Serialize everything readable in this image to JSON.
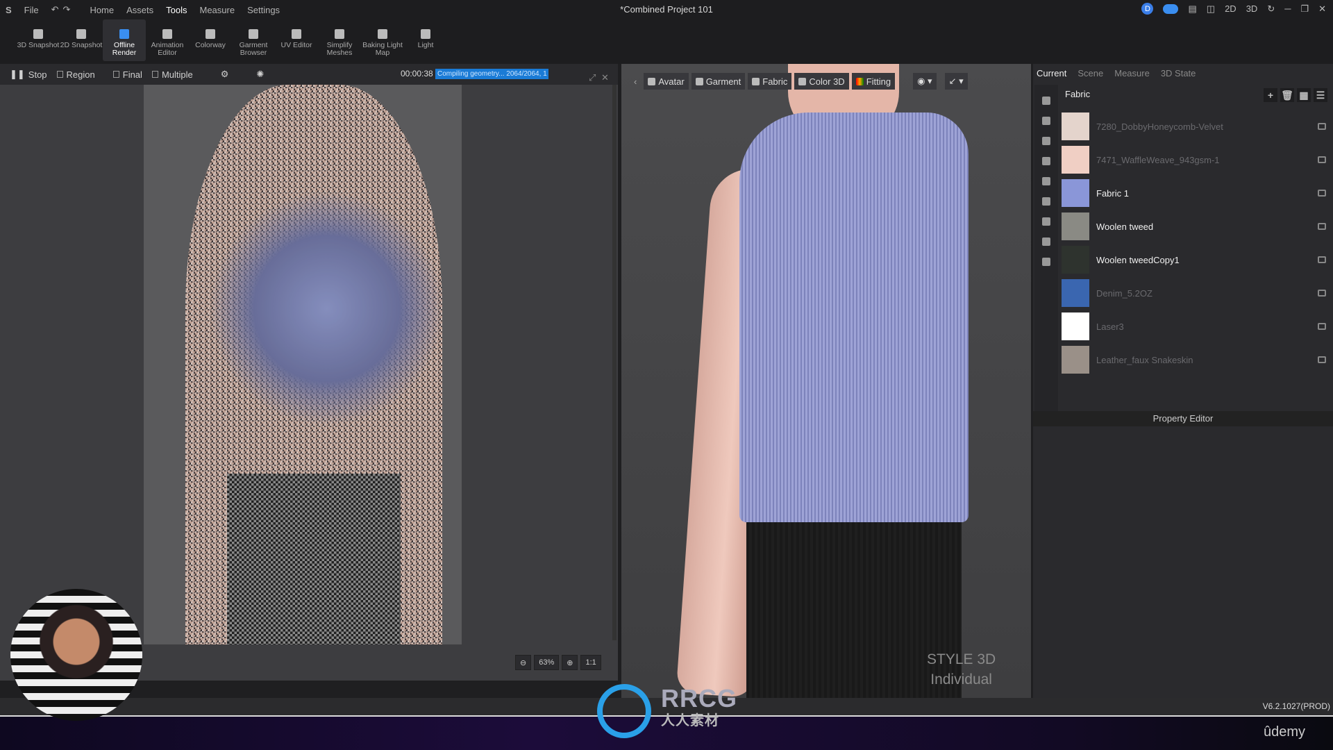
{
  "menubar": {
    "logo": "S",
    "items": [
      "File",
      "Home",
      "Assets",
      "Tools",
      "Measure",
      "Settings"
    ],
    "active": "Tools",
    "title": "*Combined Project 101",
    "right": {
      "user_initial": "D",
      "view_2d": "2D",
      "view_3d": "3D"
    }
  },
  "toolbar": [
    {
      "label": "3D Snapshot",
      "icon": "camera-icon"
    },
    {
      "label": "2D Snapshot",
      "icon": "snapshot-2d-icon"
    },
    {
      "label": "Offline Render",
      "icon": "clapper-icon",
      "active": true
    },
    {
      "label": "Animation Editor",
      "icon": "video-camera-icon"
    },
    {
      "label": "Colorway",
      "icon": "colorway-icon"
    },
    {
      "label": "Garment Browser",
      "icon": "garment-icon"
    },
    {
      "label": "UV Editor",
      "icon": "uv-icon"
    },
    {
      "label": "Simplify Meshes",
      "icon": "mesh-icon"
    },
    {
      "label": "Baking Light Map",
      "icon": "bake-light-icon"
    },
    {
      "label": "Light",
      "icon": "light-icon"
    }
  ],
  "render": {
    "stop": "Stop",
    "region": "Region",
    "final": "Final",
    "multiple": "Multiple",
    "timer": "00:00:38",
    "progress": "Compiling geometry... 2064/2064, 1",
    "zoom": "63%",
    "one_to_one": "1:1"
  },
  "viewport": {
    "tools": [
      "Avatar",
      "Garment",
      "Fabric",
      "Color 3D",
      "Fitting"
    ],
    "watermark_line1": "STYLE 3D",
    "watermark_line2": "Individual"
  },
  "rightpanel": {
    "tabs": [
      "Current",
      "Scene",
      "Measure",
      "3D State"
    ],
    "active_tab": "Current",
    "section": "Fabric",
    "fabrics": [
      {
        "name": "7280_DobbyHoneycomb-Velvet",
        "color": "#e4d4cc",
        "dim": true
      },
      {
        "name": "7471_WaffleWeave_943gsm-1",
        "color": "#f0cfc4",
        "dim": true
      },
      {
        "name": "Fabric 1",
        "color": "#8a96d8",
        "dim": false
      },
      {
        "name": "Woolen tweed",
        "color": "#8a8a84",
        "dim": false
      },
      {
        "name": "Woolen tweedCopy1",
        "color": "#2e332e",
        "dim": false
      },
      {
        "name": "Denim_5.2OZ",
        "color": "#3a66b0",
        "dim": true
      },
      {
        "name": "Laser3",
        "color": "#ffffff",
        "dim": true
      },
      {
        "name": "Leather_faux Snakeskin",
        "color": "#9a9088",
        "dim": true
      }
    ],
    "property_editor": "Property Editor"
  },
  "status": {
    "version": "V6.2.1027(PROD)"
  },
  "overlay": {
    "rrcg": "RRCG",
    "rrcg_sub": "人人素材",
    "udemy": "ûdemy"
  }
}
